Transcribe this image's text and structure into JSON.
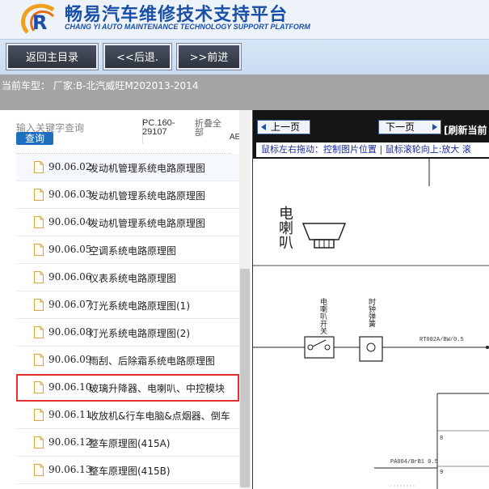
{
  "header": {
    "title_cn": "畅易汽车维修技术支持平台",
    "title_en": "CHANG YI AUTO MAINTENANCE TECHNOLOGY SUPPORT PLATFORM",
    "logo_icon": "cy-logo-icon"
  },
  "toolbar": {
    "home_label": "返回主目录",
    "back_label": "<<后退.",
    "forward_label": ">>前进"
  },
  "vehicle": {
    "label": "当前车型： 厂家:B-北汽威旺M202013-2014"
  },
  "search": {
    "placeholder": "输入关键字查询",
    "button_label": "查询",
    "code_label": "PC.160-29107",
    "fold_label": "折叠全部",
    "extra_label": "AE"
  },
  "files": [
    {
      "code": "90.06.02",
      "name": "发动机管理系统电路原理图"
    },
    {
      "code": "90.06.03",
      "name": "发动机管理系统电路原理图"
    },
    {
      "code": "90.06.04",
      "name": "发动机管理系统电路原理图"
    },
    {
      "code": "90.06.05",
      "name": "空调系统电路原理图"
    },
    {
      "code": "90.06.06",
      "name": "仪表系统电路原理图"
    },
    {
      "code": "90.06.07",
      "name": "灯光系统电路原理图(1)"
    },
    {
      "code": "90.06.08",
      "name": "灯光系统电路原理图(2)"
    },
    {
      "code": "90.06.09",
      "name": "雨刮、后除霜系统电路原理图"
    },
    {
      "code": "90.06.10",
      "name": "玻璃升降器、电喇叭、中控模块"
    },
    {
      "code": "90.06.11",
      "name": "收放机&行车电脑&点烟器、倒车"
    },
    {
      "code": "90.06.12",
      "name": "整车原理图(415A)"
    },
    {
      "code": "90.06.13",
      "name": "整车原理图(415B)"
    }
  ],
  "selected_index": 8,
  "viewer": {
    "prev_label": "上一页",
    "next_label": "下一页",
    "refresh_label": "[刷新当前",
    "instructions": "鼠标左右拖动：控制图片位置 | 鼠标滚轮向上:放大  滚"
  },
  "diagram": {
    "title": "电喇叭",
    "horn_switch_label": "电喇叭开关",
    "clock_spring_label": "时钟弹簧",
    "wire1_label": "RT002A/BW/0.5",
    "wire2_label": "PA004/BrB1 0.5",
    "pin1_label": "8",
    "pin2_label": "9"
  },
  "colors": {
    "brand_blue": "#1a4fa8",
    "highlight_red": "#e03030",
    "search_button": "#1f6fbf",
    "viewer_bar": "#151515"
  }
}
